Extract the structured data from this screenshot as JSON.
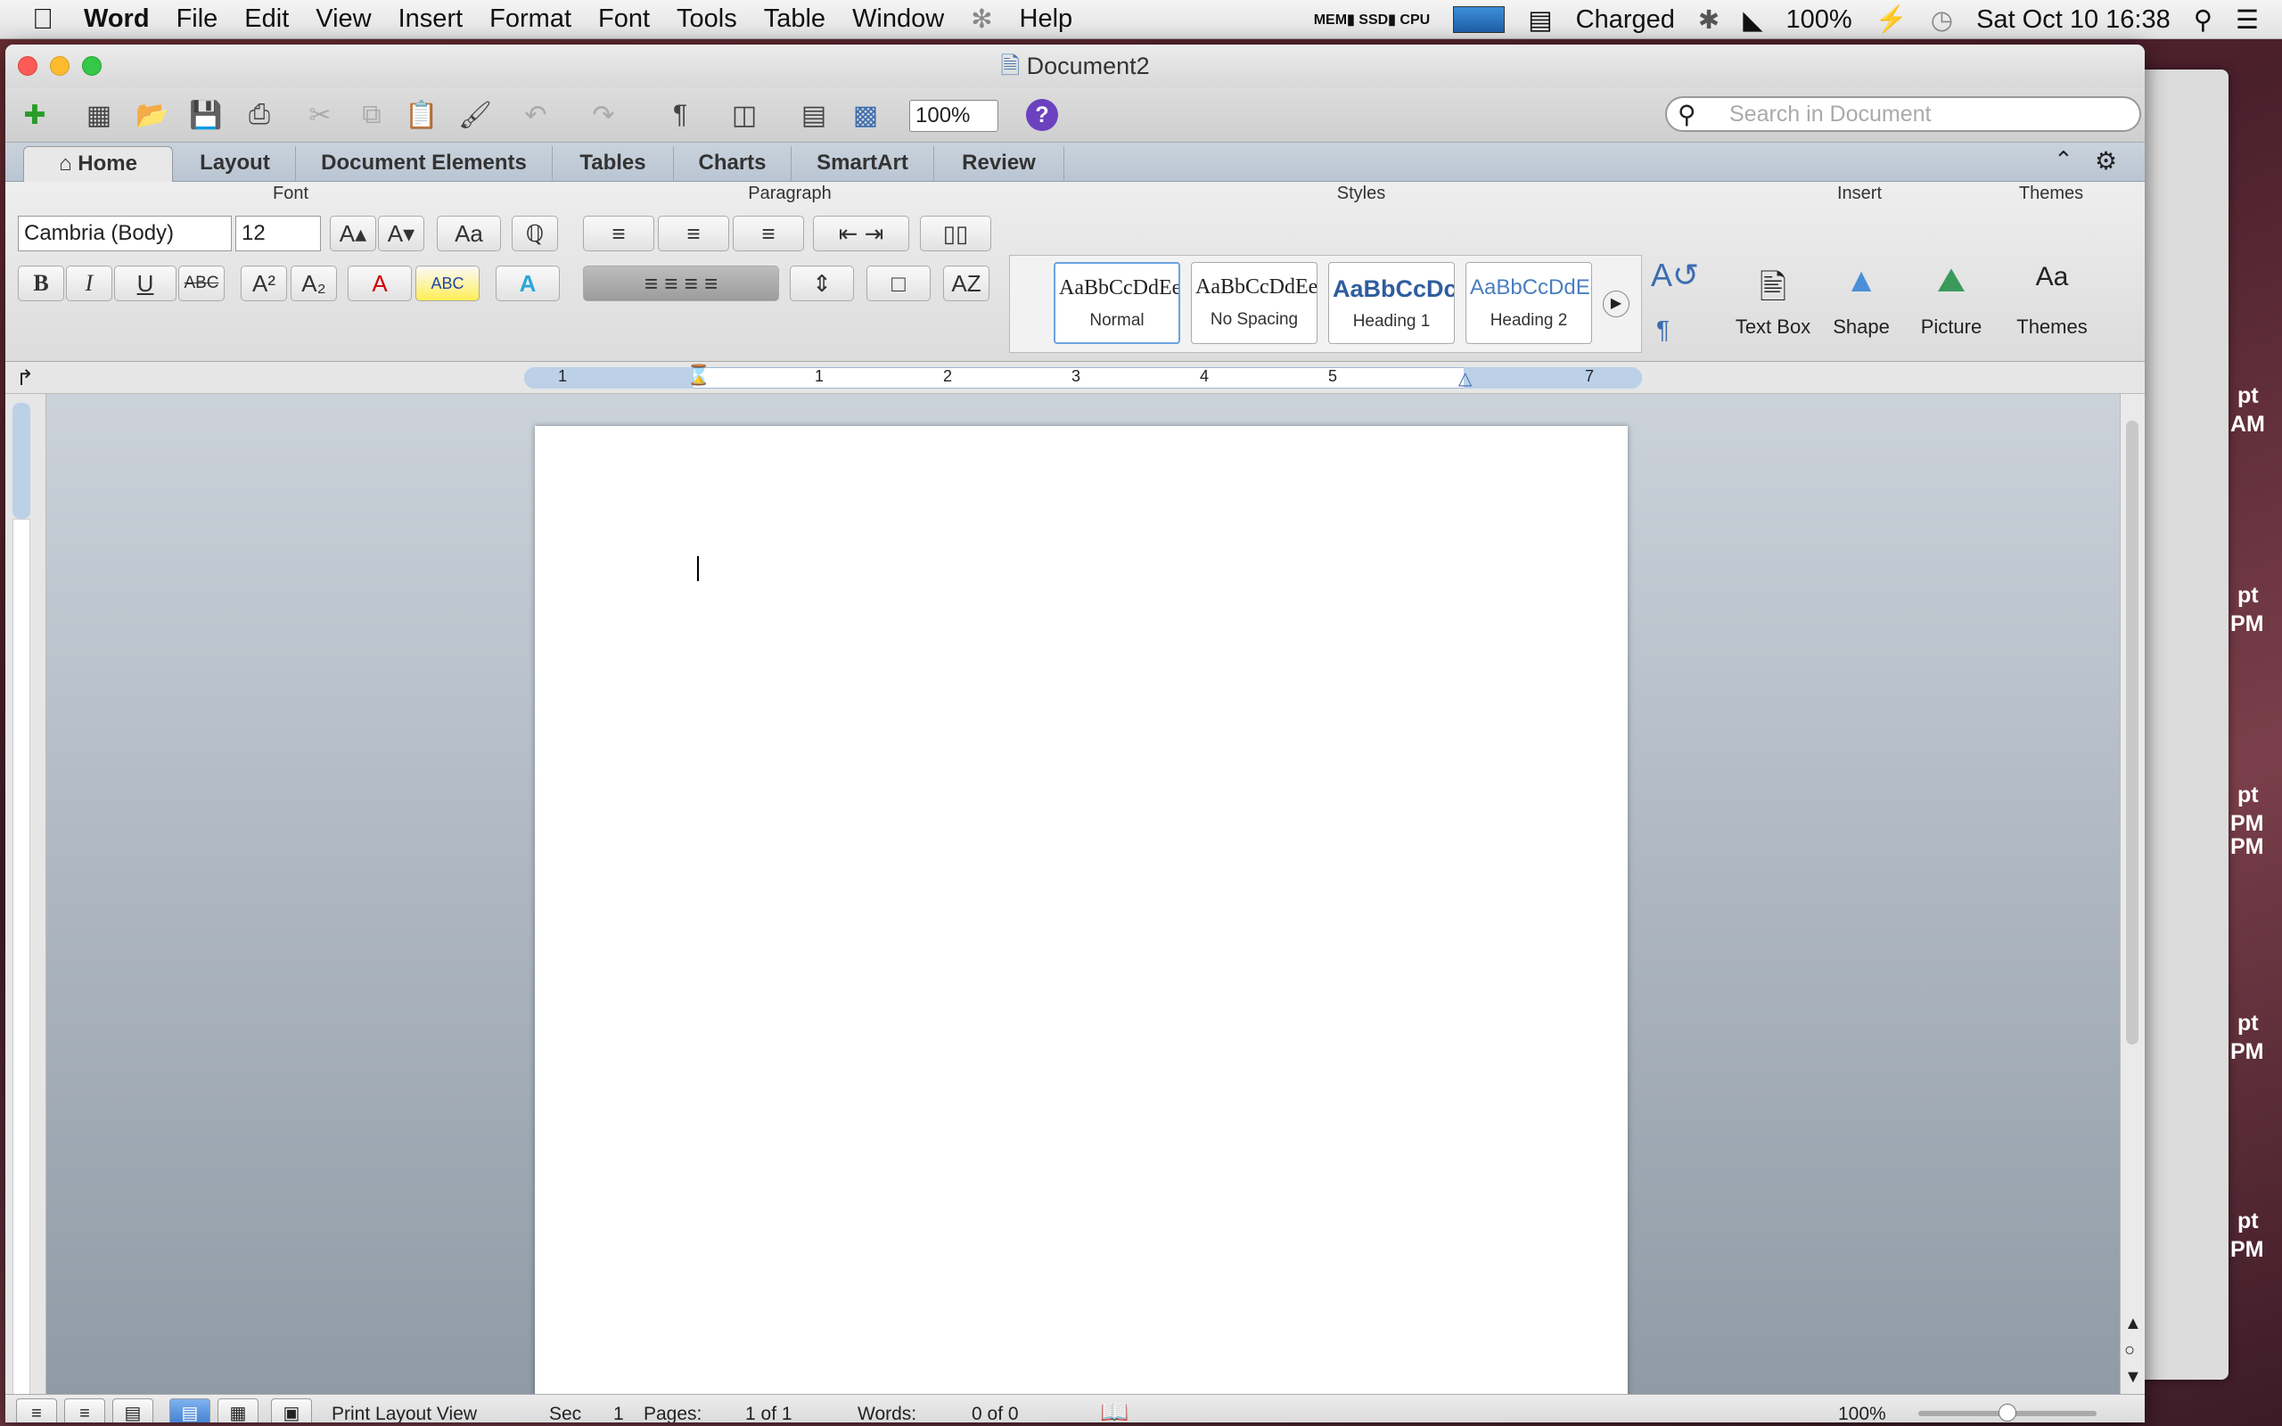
{
  "menubar": {
    "app": "Word",
    "items": [
      "File",
      "Edit",
      "View",
      "Insert",
      "Format",
      "Font",
      "Tools",
      "Table",
      "Window",
      "Help"
    ],
    "battery_status": "Charged",
    "battery_pct": "100%",
    "datetime": "Sat Oct 10  16:38"
  },
  "window": {
    "title": "Document2"
  },
  "toolbar": {
    "zoom": "100%",
    "search_placeholder": "Search in Document"
  },
  "tabs": [
    "Home",
    "Layout",
    "Document Elements",
    "Tables",
    "Charts",
    "SmartArt",
    "Review"
  ],
  "ribbon": {
    "font_group": "Font",
    "paragraph_group": "Paragraph",
    "styles_group": "Styles",
    "insert_group": "Insert",
    "themes_group": "Themes",
    "font_name": "Cambria (Body)",
    "font_size": "12",
    "styles": [
      {
        "preview": "AaBbCcDdEe",
        "name": "Normal"
      },
      {
        "preview": "AaBbCcDdEe",
        "name": "No Spacing"
      },
      {
        "preview": "AaBbCcDc",
        "name": "Heading 1"
      },
      {
        "preview": "AaBbCcDdEe",
        "name": "Heading 2"
      }
    ],
    "insert_items": [
      "Text Box",
      "Shape",
      "Picture"
    ],
    "themes_label": "Themes"
  },
  "ruler": {
    "ticks": [
      "1",
      "1",
      "2",
      "3",
      "4",
      "5",
      "7"
    ]
  },
  "statusbar": {
    "view": "Print Layout View",
    "sec_label": "Sec",
    "sec": "1",
    "pages_label": "Pages:",
    "pages": "1 of 1",
    "words_label": "Words:",
    "words": "0 of 0",
    "zoom": "100%"
  },
  "background_window": {
    "texts": [
      "pt",
      "AM",
      "pt",
      "PM",
      "pt",
      "PM",
      "PM",
      "pt",
      "PM",
      "pt",
      "PM"
    ]
  }
}
